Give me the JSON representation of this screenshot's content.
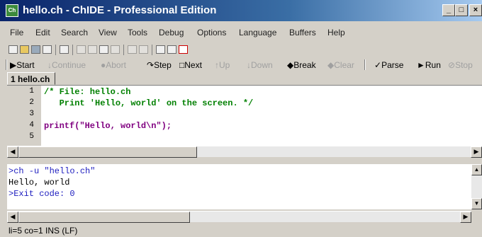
{
  "window": {
    "title": "hello.ch - ChIDE - Professional Edition",
    "icon_label": "Ch",
    "controls": {
      "minimize": "_",
      "maximize": "□",
      "close": "×"
    }
  },
  "menu": [
    "File",
    "Edit",
    "Search",
    "View",
    "Tools",
    "Debug",
    "Options",
    "Language",
    "Buffers",
    "Help"
  ],
  "debug_toolbar": {
    "start": "Start",
    "continue": "Continue",
    "abort": "Abort",
    "step": "Step",
    "next": "Next",
    "up": "Up",
    "down": "Down",
    "break": "Break",
    "clear": "Clear",
    "parse": "Parse",
    "run": "Run",
    "stop": "Stop"
  },
  "file_tab": "1 hello.ch",
  "editor": {
    "line_numbers": [
      "1",
      "2",
      "3",
      "4",
      "5"
    ],
    "lines": [
      "/* File: hello.ch",
      "   Print 'Hello, world' on the screen. */",
      "",
      "printf(\"Hello, world\\n\");",
      ""
    ]
  },
  "output": {
    "lines": [
      ">ch -u \"hello.ch\"",
      "Hello, world",
      ">Exit code: 0"
    ]
  },
  "status": "li=5 co=1 INS (LF)",
  "colors": {
    "title_gradient_start": "#0a246a",
    "comment_color": "#008000",
    "function_color": "#800080",
    "output_command_color": "#2020c0"
  }
}
